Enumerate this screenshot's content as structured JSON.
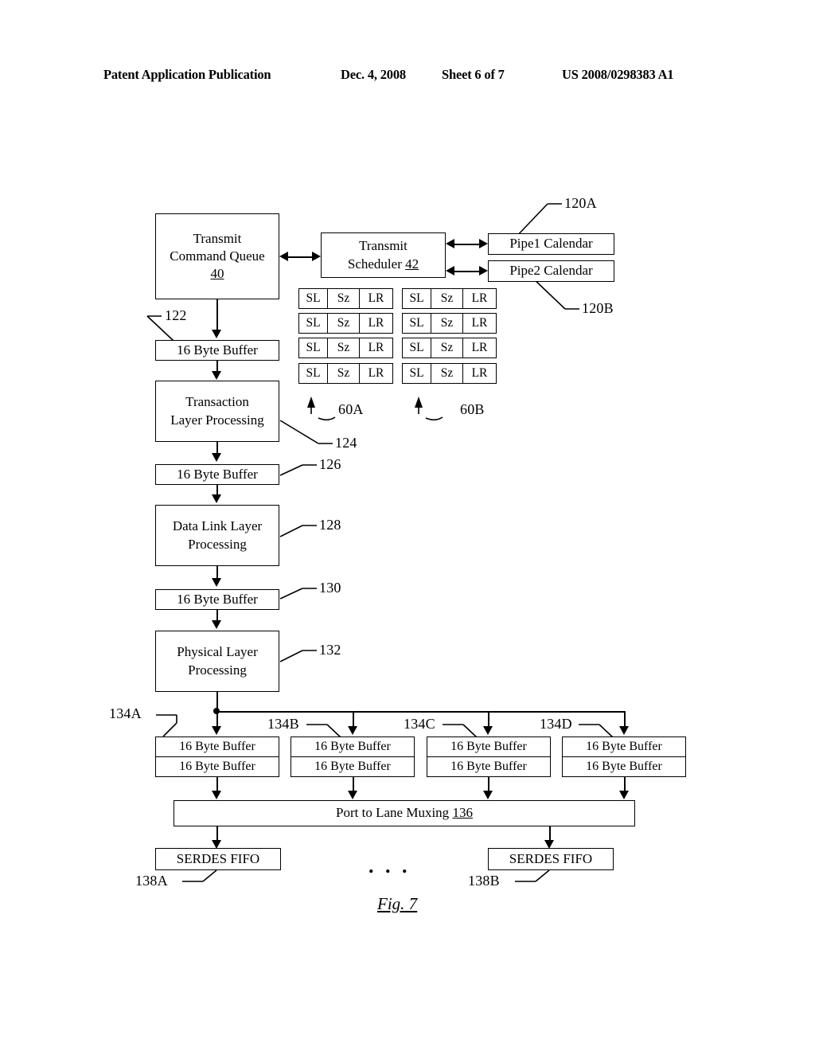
{
  "header": {
    "publication": "Patent Application Publication",
    "date": "Dec. 4, 2008",
    "sheet": "Sheet 6 of 7",
    "number": "US 2008/0298383 A1"
  },
  "figure": {
    "label": "Fig. 7",
    "ellipsis": ". . ."
  },
  "blocks": {
    "transmit_command_queue": {
      "line1": "Transmit",
      "line2": "Command Queue",
      "ref": "40"
    },
    "transmit_scheduler": {
      "line1": "Transmit",
      "line2": "Scheduler",
      "ref": "42"
    },
    "pipe1_calendar": "Pipe1 Calendar",
    "pipe2_calendar": "Pipe2 Calendar",
    "buffer_122": "16 Byte Buffer",
    "transaction_layer": {
      "line1": "Transaction",
      "line2": "Layer Processing"
    },
    "buffer_126": "16 Byte Buffer",
    "data_link_layer": {
      "line1": "Data Link Layer",
      "line2": "Processing"
    },
    "buffer_130": "16 Byte Buffer",
    "physical_layer": {
      "line1": "Physical Layer",
      "line2": "Processing"
    },
    "port_to_lane_muxing": {
      "text": "Port to Lane Muxing",
      "ref": "136"
    },
    "serdes_fifo_a": "SERDES FIFO",
    "serdes_fifo_b": "SERDES FIFO",
    "lane_buffer_label": "16 Byte Buffer"
  },
  "calendar_cells": {
    "headers": [
      "SL",
      "Sz",
      "LR"
    ],
    "group_60A": [
      [
        "SL",
        "Sz",
        "LR"
      ],
      [
        "SL",
        "Sz",
        "LR"
      ],
      [
        "SL",
        "Sz",
        "LR"
      ],
      [
        "SL",
        "Sz",
        "LR"
      ]
    ],
    "group_60B": [
      [
        "SL",
        "Sz",
        "LR"
      ],
      [
        "SL",
        "Sz",
        "LR"
      ],
      [
        "SL",
        "Sz",
        "LR"
      ],
      [
        "SL",
        "Sz",
        "LR"
      ]
    ]
  },
  "lane_buffer_groups": [
    {
      "ref": "134A",
      "rows": [
        "16 Byte Buffer",
        "16 Byte Buffer"
      ]
    },
    {
      "ref": "134B",
      "rows": [
        "16 Byte Buffer",
        "16 Byte Buffer"
      ]
    },
    {
      "ref": "134C",
      "rows": [
        "16 Byte Buffer",
        "16 Byte Buffer"
      ]
    },
    {
      "ref": "134D",
      "rows": [
        "16 Byte Buffer",
        "16 Byte Buffer"
      ]
    }
  ],
  "refs": {
    "r120A": "120A",
    "r120B": "120B",
    "r122": "122",
    "r124": "124",
    "r126": "126",
    "r128": "128",
    "r130": "130",
    "r132": "132",
    "r134A": "134A",
    "r134B": "134B",
    "r134C": "134C",
    "r134D": "134D",
    "r138A": "138A",
    "r138B": "138B",
    "r60A": "60A",
    "r60B": "60B"
  }
}
